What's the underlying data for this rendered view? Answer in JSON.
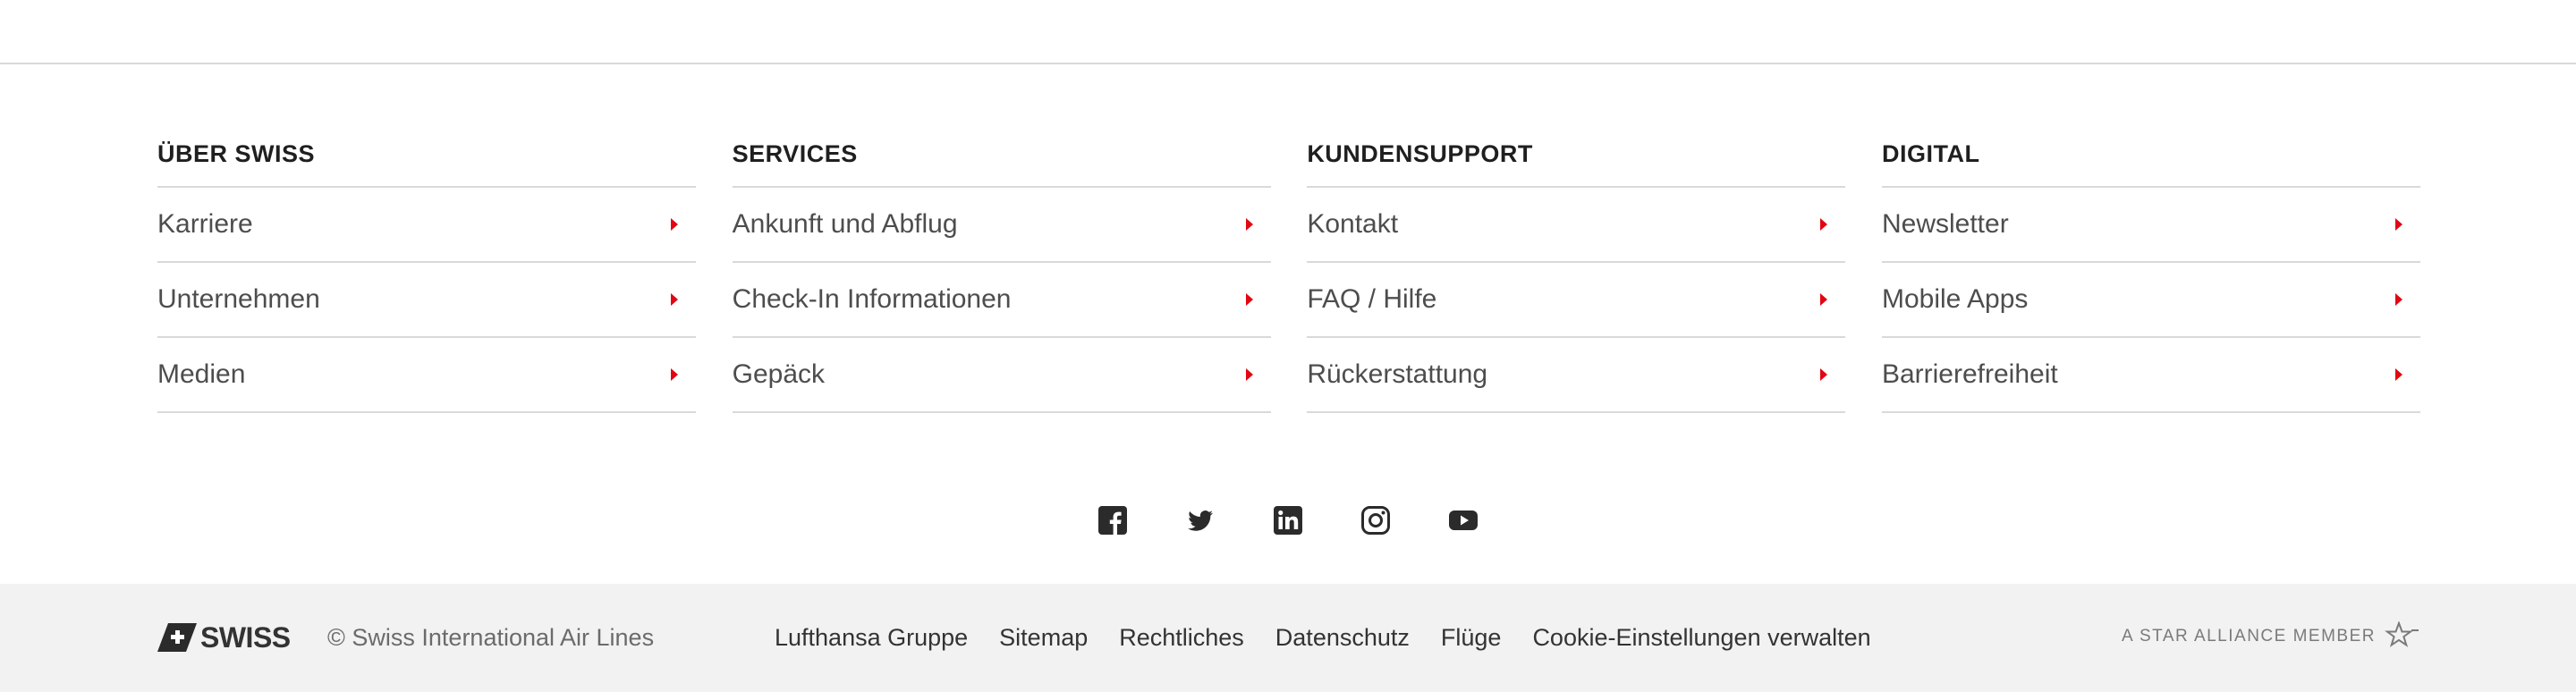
{
  "footer": {
    "columns": [
      {
        "title": "ÜBER SWISS",
        "links": [
          "Karriere",
          "Unternehmen",
          "Medien"
        ]
      },
      {
        "title": "SERVICES",
        "links": [
          "Ankunft und Abflug",
          "Check-In Informationen",
          "Gepäck"
        ]
      },
      {
        "title": "KUNDENSUPPORT",
        "links": [
          "Kontakt",
          "FAQ / Hilfe",
          "Rückerstattung"
        ]
      },
      {
        "title": "DIGITAL",
        "links": [
          "Newsletter",
          "Mobile Apps",
          "Barrierefreiheit"
        ]
      }
    ],
    "social_icons": [
      "facebook-icon",
      "twitter-icon",
      "linkedin-icon",
      "instagram-icon",
      "youtube-icon"
    ],
    "accent_color": "#e20613"
  },
  "bottom_bar": {
    "logo_text": "SWISS",
    "copyright": "© Swiss International Air Lines",
    "links": [
      "Lufthansa Gruppe",
      "Sitemap",
      "Rechtliches",
      "Datenschutz",
      "Flüge",
      "Cookie-Einstellungen verwalten"
    ],
    "star_alliance": "A STAR ALLIANCE MEMBER"
  }
}
